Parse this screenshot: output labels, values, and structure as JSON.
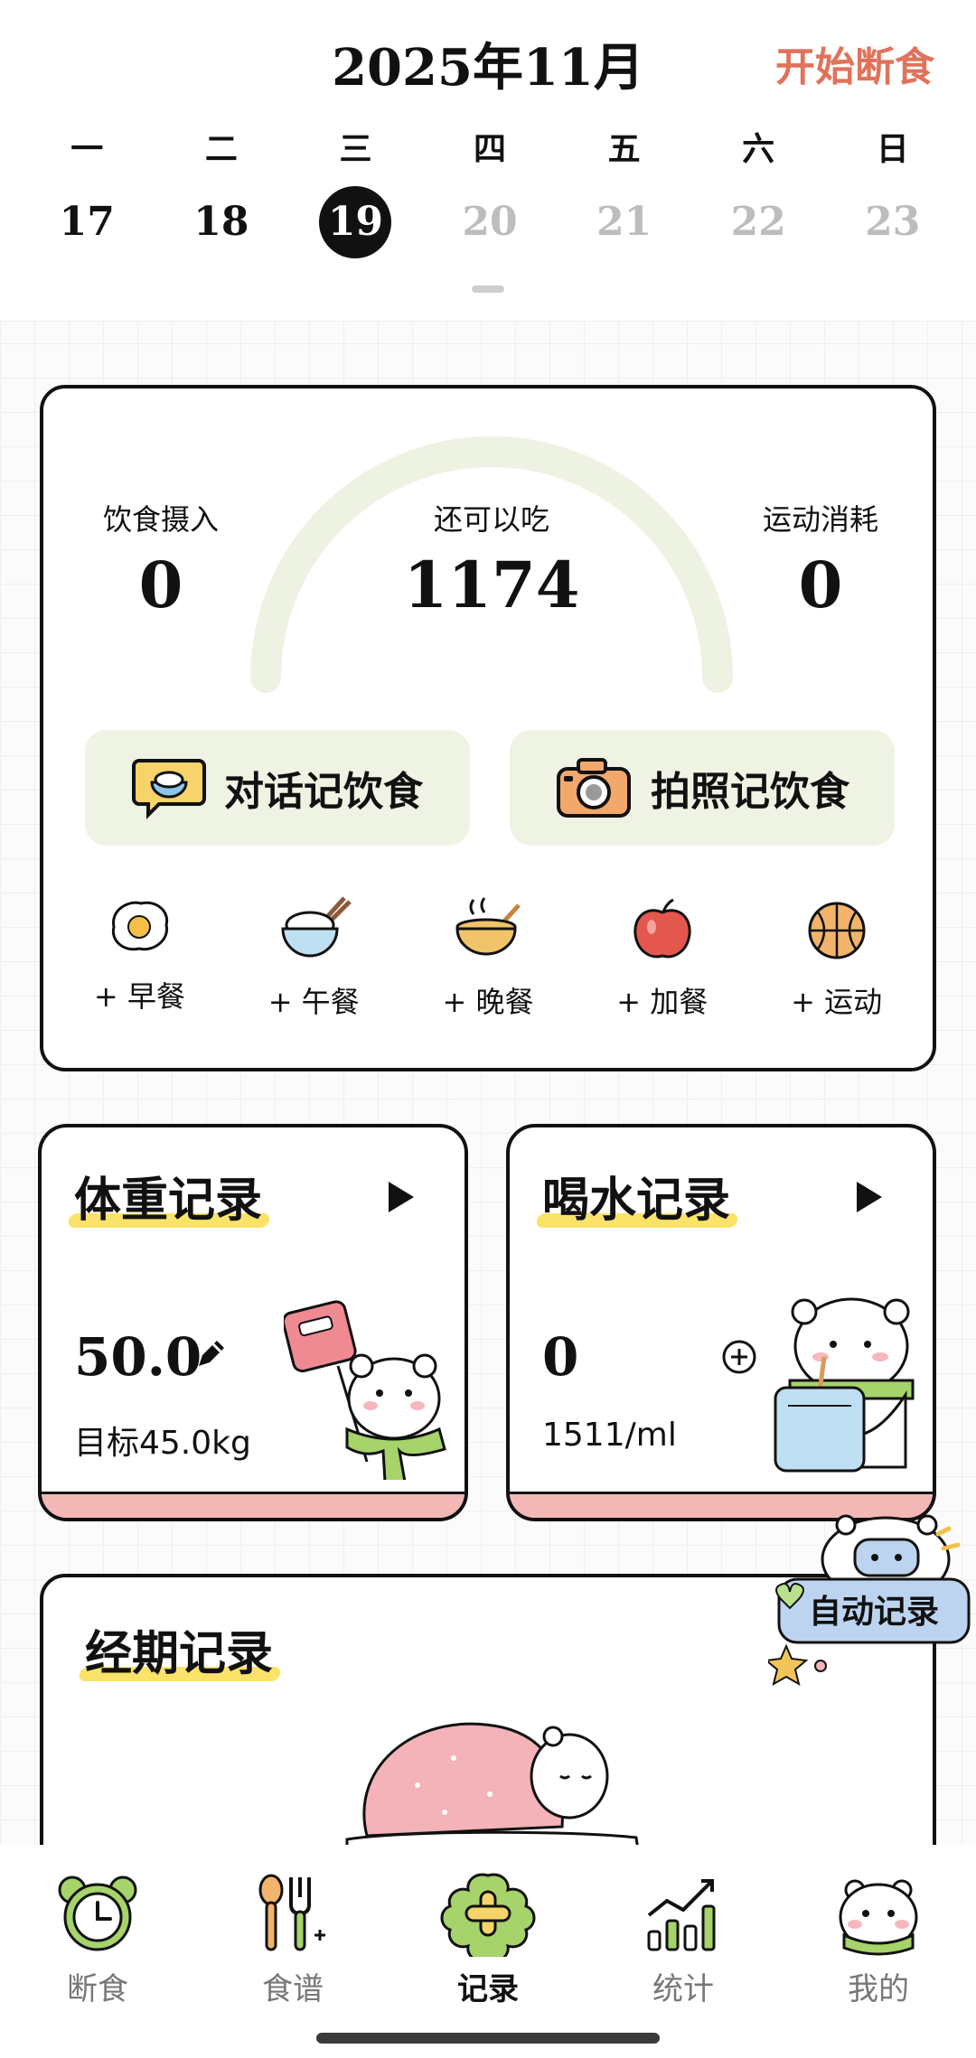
{
  "header": {
    "title": "2025年11月",
    "action_label": "开始断食",
    "weekdays": [
      "一",
      "二",
      "三",
      "四",
      "五",
      "六",
      "日"
    ],
    "dates": [
      "17",
      "18",
      "19",
      "20",
      "21",
      "22",
      "23"
    ],
    "selected_date": "19"
  },
  "calories": {
    "intake_label": "饮食摄入",
    "intake_value": "0",
    "remaining_label": "还可以吃",
    "remaining_value": "1174",
    "burned_label": "运动消耗",
    "burned_value": "0"
  },
  "log_buttons": {
    "chat_label": "对话记饮食",
    "photo_label": "拍照记饮食"
  },
  "meals": [
    {
      "label": "+ 早餐",
      "icon": "fried-egg-icon"
    },
    {
      "label": "+ 午餐",
      "icon": "rice-bowl-icon"
    },
    {
      "label": "+ 晚餐",
      "icon": "soup-bowl-icon"
    },
    {
      "label": "+ 加餐",
      "icon": "apple-icon"
    },
    {
      "label": "+ 运动",
      "icon": "basketball-icon"
    }
  ],
  "weight": {
    "title": "体重记录",
    "value": "50.0",
    "goal": "目标45.0kg"
  },
  "water": {
    "title": "喝水记录",
    "value": "0",
    "target": "1511/ml"
  },
  "period": {
    "title": "经期记录",
    "badge": "自动记录"
  },
  "nav": [
    {
      "label": "断食",
      "icon": "alarm-clock-icon"
    },
    {
      "label": "食谱",
      "icon": "utensils-icon"
    },
    {
      "label": "记录",
      "icon": "add-record-icon"
    },
    {
      "label": "统计",
      "icon": "bar-chart-icon"
    },
    {
      "label": "我的",
      "icon": "bear-profile-icon"
    }
  ],
  "colors": {
    "accent": "#e0725a",
    "gauge_track": "#eef2e2",
    "button_bg": "#eff3e3",
    "highlight": "#fbe36a",
    "card_base": "#f3b8b6"
  }
}
